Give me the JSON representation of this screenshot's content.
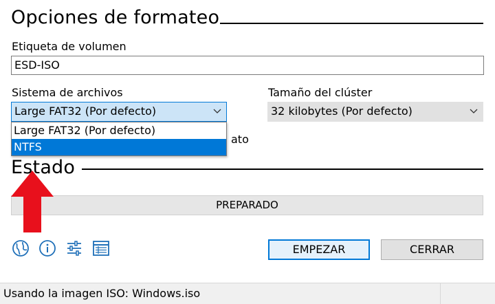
{
  "format_options": {
    "title": "Opciones de formateo",
    "volume_label": {
      "label": "Etiqueta de volumen",
      "value": "ESD-ISO"
    },
    "file_system": {
      "label": "Sistema de archivos",
      "selected": "Large FAT32 (Por defecto)",
      "options": [
        "Large FAT32 (Por defecto)",
        "NTFS"
      ],
      "highlighted": "NTFS"
    },
    "cluster_size": {
      "label": "Tamaño del clúster",
      "selected": "32 kilobytes (Por defecto)"
    },
    "hidden_text_fragment": "ato"
  },
  "status": {
    "title": "Estado",
    "progress_text": "PREPARADO"
  },
  "toolbar": {
    "icons": [
      "globe-icon",
      "info-icon",
      "settings-sliders-icon",
      "log-table-icon"
    ]
  },
  "actions": {
    "start_label": "EMPEZAR",
    "close_label": "CERRAR"
  },
  "statusbar": {
    "text": "Usando la imagen ISO: Windows.iso"
  },
  "annotation": {
    "arrow_color": "#e8101c"
  },
  "colors": {
    "accent": "#0078d7",
    "combo_active_bg": "#cce4f7"
  }
}
